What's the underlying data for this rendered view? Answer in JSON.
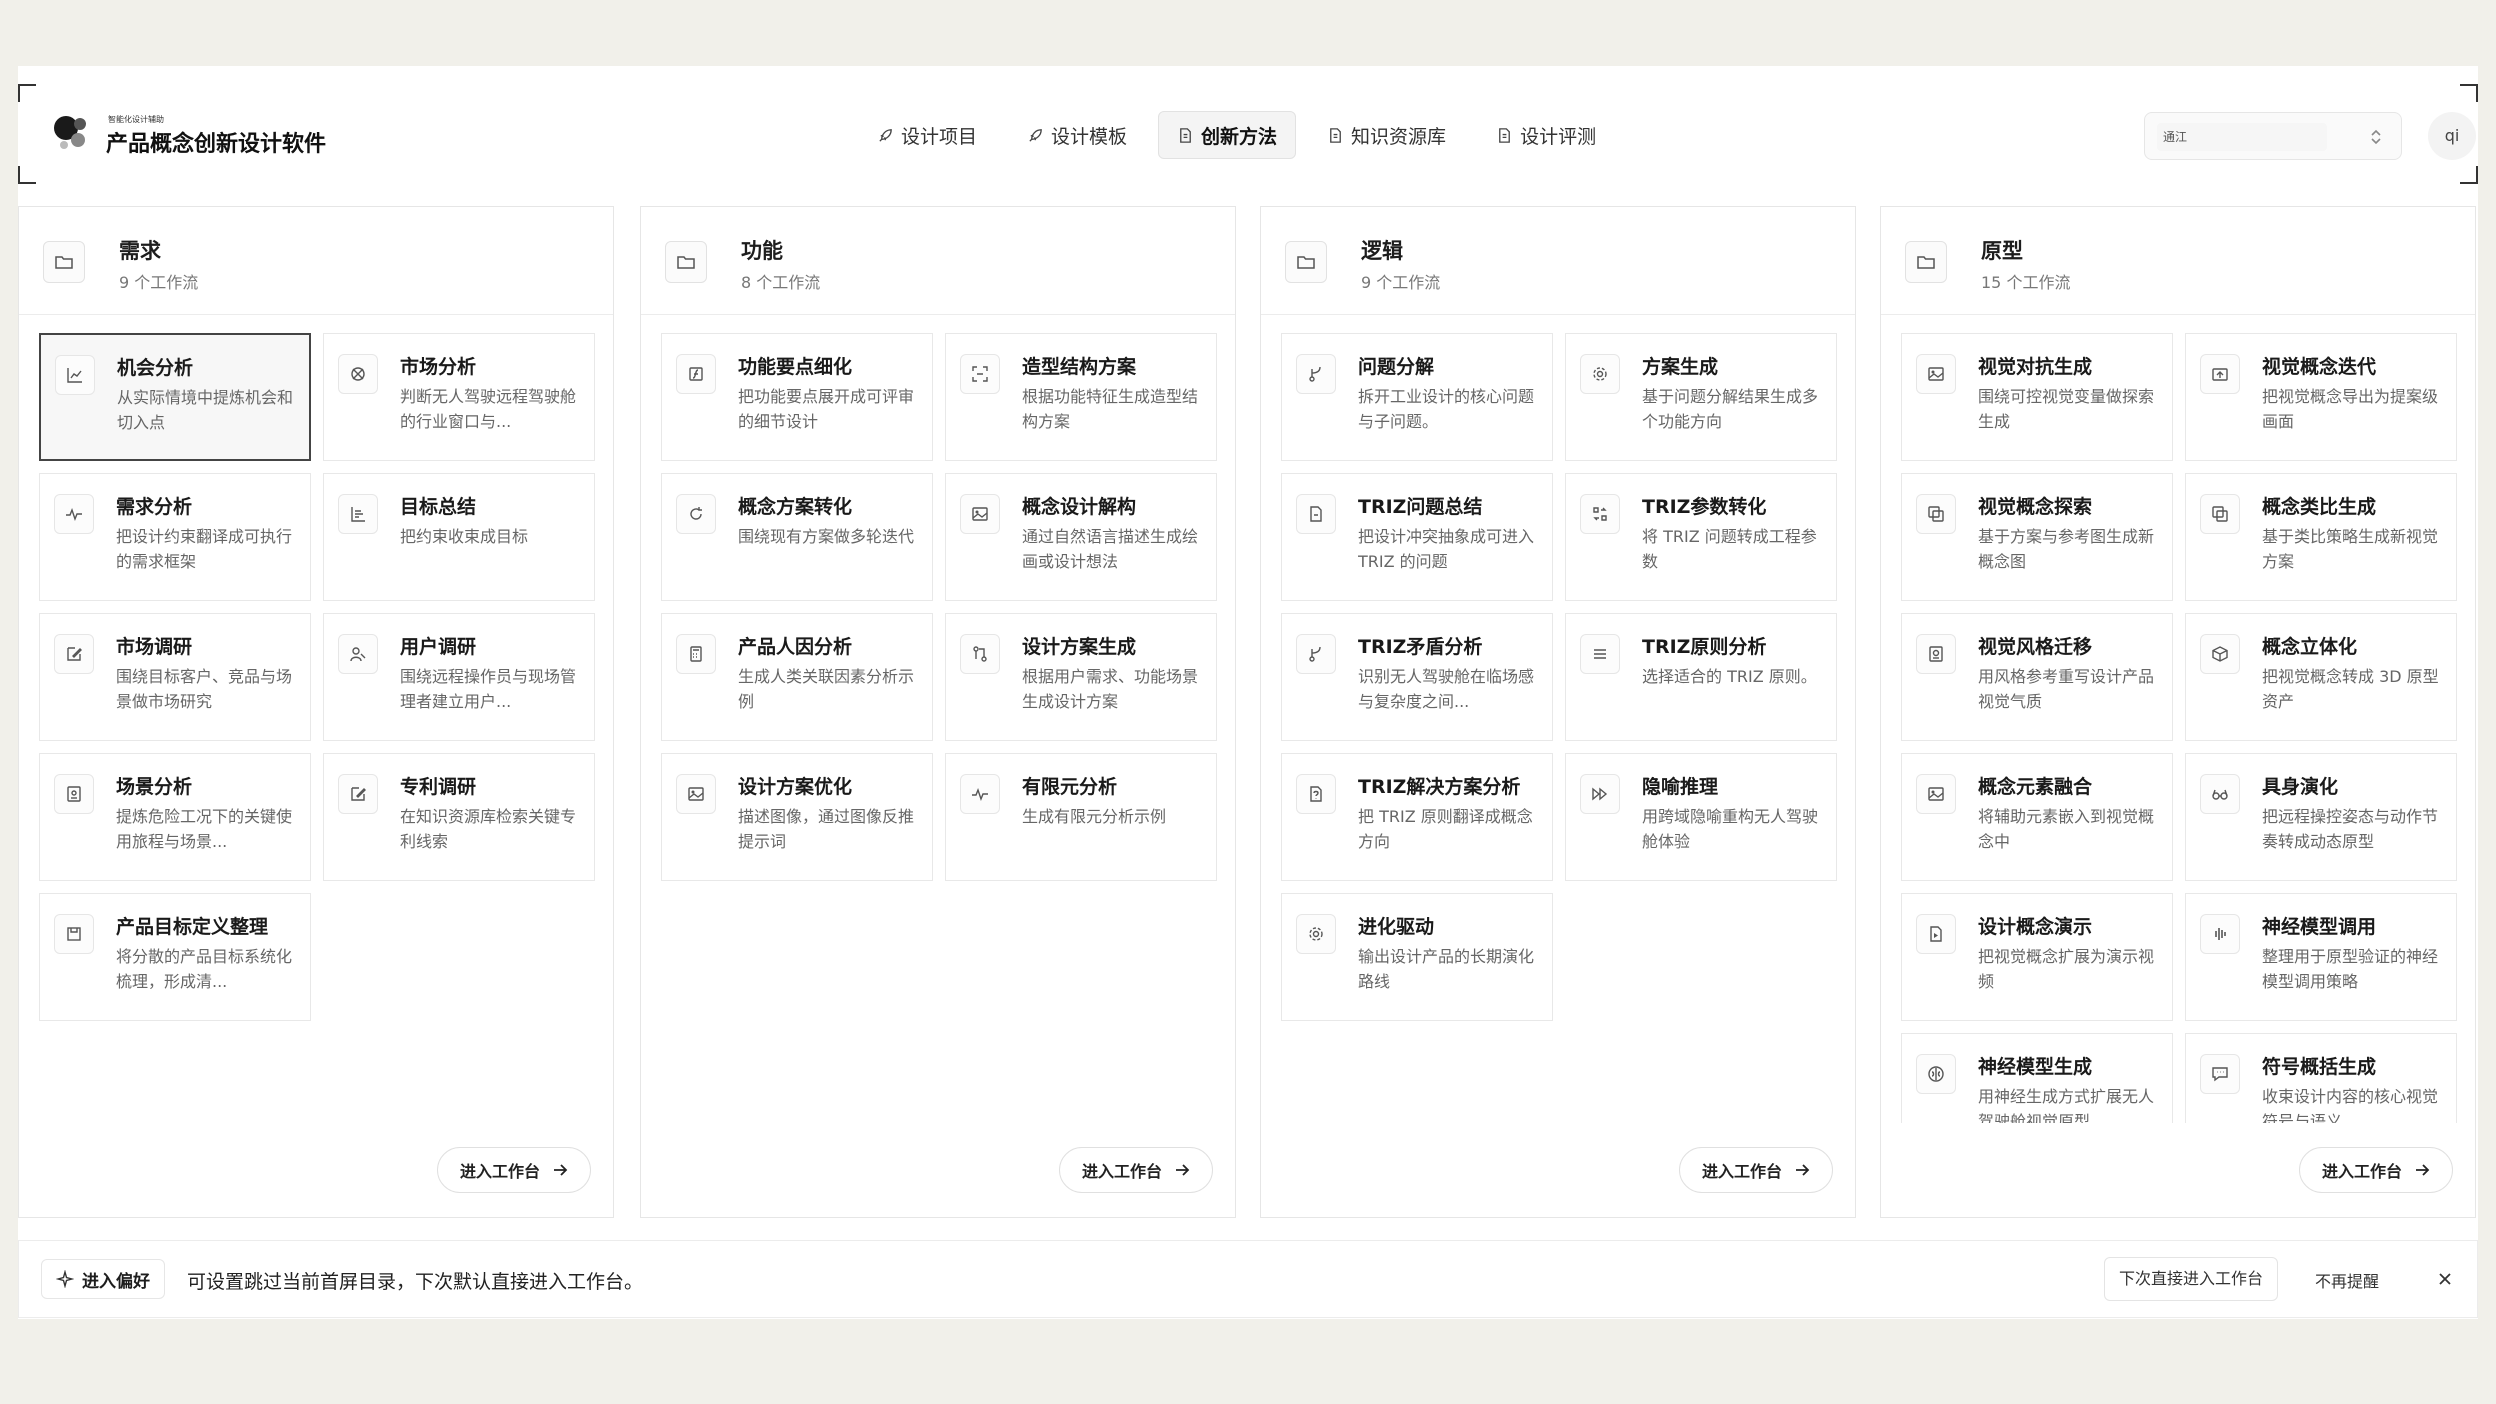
{
  "app": {
    "subtitle": "智能化设计辅助",
    "title": "产品概念创新设计软件"
  },
  "nav": [
    {
      "label": "设计项目",
      "icon": "rocket-icon",
      "active": false
    },
    {
      "label": "设计模板",
      "icon": "rocket-icon",
      "active": false
    },
    {
      "label": "创新方法",
      "icon": "document-icon",
      "active": true
    },
    {
      "label": "知识资源库",
      "icon": "document-icon",
      "active": false
    },
    {
      "label": "设计评测",
      "icon": "document-icon",
      "active": false
    }
  ],
  "model_select": {
    "value": "通江"
  },
  "user": {
    "initials": "qi"
  },
  "enter_label": "进入工作台",
  "columns": [
    {
      "title": "需求",
      "subtitle": "9 个工作流",
      "cards": [
        {
          "title": "机会分析",
          "desc": "从实际情境中提炼机会和切入点",
          "icon": "chart-icon",
          "selected": true
        },
        {
          "title": "市场分析",
          "desc": "判断无人驾驶远程驾驶舱的行业窗口与...",
          "icon": "target-icon"
        },
        {
          "title": "需求分析",
          "desc": "把设计约束翻译成可执行的需求框架",
          "icon": "pulse-icon"
        },
        {
          "title": "目标总结",
          "desc": "把约束收束成目标",
          "icon": "bars-icon"
        },
        {
          "title": "市场调研",
          "desc": "围绕目标客户、竞品与场景做市场研究",
          "icon": "edit-icon"
        },
        {
          "title": "用户调研",
          "desc": "围绕远程操作员与现场管理者建立用户...",
          "icon": "user-icon"
        },
        {
          "title": "场景分析",
          "desc": "提炼危险工况下的关键使用旅程与场景...",
          "icon": "frame-icon"
        },
        {
          "title": "专利调研",
          "desc": "在知识资源库检索关键专利线索",
          "icon": "edit-icon"
        },
        {
          "title": "产品目标定义整理",
          "desc": "将分散的产品目标系统化梳理，形成清...",
          "icon": "save-icon"
        }
      ]
    },
    {
      "title": "功能",
      "subtitle": "8 个工作流",
      "cards": [
        {
          "title": "功能要点细化",
          "desc": "把功能要点展开成可评审的细节设计",
          "icon": "formula-icon"
        },
        {
          "title": "造型结构方案",
          "desc": "根据功能特征生成造型结构方案",
          "icon": "scan-icon"
        },
        {
          "title": "概念方案转化",
          "desc": "围绕现有方案做多轮迭代",
          "icon": "refresh-icon"
        },
        {
          "title": "概念设计解构",
          "desc": "通过自然语言描述生成绘画或设计想法",
          "icon": "image-icon"
        },
        {
          "title": "产品人因分析",
          "desc": "生成人类关联因素分析示例",
          "icon": "calc-icon"
        },
        {
          "title": "设计方案生成",
          "desc": "根据用户需求、功能场景生成设计方案",
          "icon": "merge-icon"
        },
        {
          "title": "设计方案优化",
          "desc": "描述图像，通过图像反推提示词",
          "icon": "image-icon"
        },
        {
          "title": "有限元分析",
          "desc": "生成有限元分析示例",
          "icon": "pulse-icon"
        }
      ]
    },
    {
      "title": "逻辑",
      "subtitle": "9 个工作流",
      "cards": [
        {
          "title": "问题分解",
          "desc": "拆开工业设计的核心问题与子问题。",
          "icon": "split-icon"
        },
        {
          "title": "方案生成",
          "desc": "基于问题分解结果生成多个功能方向",
          "icon": "gear-icon"
        },
        {
          "title": "TRIZ问题总结",
          "desc": "把设计冲突抽象成可进入 TRIZ 的问题",
          "icon": "doc-icon"
        },
        {
          "title": "TRIZ参数转化",
          "desc": "将 TRIZ 问题转成工程参数",
          "icon": "convert-icon"
        },
        {
          "title": "TRIZ矛盾分析",
          "desc": "识别无人驾驶舱在临场感与复杂度之间...",
          "icon": "split-icon"
        },
        {
          "title": "TRIZ原则分析",
          "desc": "选择适合的 TRIZ 原则。",
          "icon": "menu-icon"
        },
        {
          "title": "TRIZ解决方案分析",
          "desc": "把 TRIZ 原则翻译成概念方向",
          "icon": "question-icon"
        },
        {
          "title": "隐喻推理",
          "desc": "用跨域隐喻重构无人驾驶舱体验",
          "icon": "forward-icon"
        },
        {
          "title": "进化驱动",
          "desc": "输出设计产品的长期演化路线",
          "icon": "gear-icon"
        }
      ]
    },
    {
      "title": "原型",
      "subtitle": "15 个工作流",
      "cards": [
        {
          "title": "视觉对抗生成",
          "desc": "围绕可控视觉变量做探索生成",
          "icon": "image-icon"
        },
        {
          "title": "视觉概念迭代",
          "desc": "把视觉概念导出为提案级画面",
          "icon": "export-icon"
        },
        {
          "title": "视觉概念探索",
          "desc": "基于方案与参考图生成新概念图",
          "icon": "copy-icon"
        },
        {
          "title": "概念类比生成",
          "desc": "基于类比策略生成新视觉方案",
          "icon": "copy-icon"
        },
        {
          "title": "视觉风格迁移",
          "desc": "用风格参考重写设计产品视觉气质",
          "icon": "style-icon"
        },
        {
          "title": "概念立体化",
          "desc": "把视觉概念转成 3D 原型资产",
          "icon": "cube-icon"
        },
        {
          "title": "概念元素融合",
          "desc": "将辅助元素嵌入到视觉概念中",
          "icon": "image-icon"
        },
        {
          "title": "具身演化",
          "desc": "把远程操控姿态与动作节奏转成动态原型",
          "icon": "glasses-icon"
        },
        {
          "title": "设计概念演示",
          "desc": "把视觉概念扩展为演示视频",
          "icon": "play-icon"
        },
        {
          "title": "神经模型调用",
          "desc": "整理用于原型验证的神经模型调用策略",
          "icon": "wave-icon"
        },
        {
          "title": "神经模型生成",
          "desc": "用神经生成方式扩展无人驾驶舱视觉原型",
          "icon": "brain-icon"
        },
        {
          "title": "符号概括生成",
          "desc": "收束设计内容的核心视觉符号与语义",
          "icon": "chat-icon"
        }
      ]
    }
  ],
  "bottom_bar": {
    "tag": "进入偏好",
    "text": "可设置跳过当前首屏目录，下次默认直接进入工作台。",
    "primary": "下次直接进入工作台",
    "secondary": "不再提醒"
  }
}
